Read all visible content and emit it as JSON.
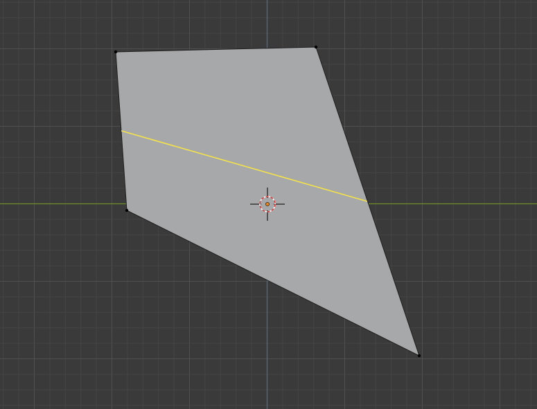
{
  "viewport": {
    "background_color": "#3a3a3a",
    "grid_minor_color": "#454545",
    "grid_major_color": "#505050",
    "x_axis_color": "#6f8f2a",
    "y_axis_color": "#3f6db8"
  },
  "mesh": {
    "face_color": "#a7a8a9",
    "edge_color": "#1e1e1e",
    "vertex_color": "#000000",
    "selected_edge_color": "#f5e34a",
    "mode": "edit-mode"
  },
  "cursor_3d": {
    "ring_color_a": "#d23a3a",
    "ring_color_b": "#ffffff",
    "crosshair_color": "#1a1a1a",
    "origin_color": "#e8851e"
  }
}
